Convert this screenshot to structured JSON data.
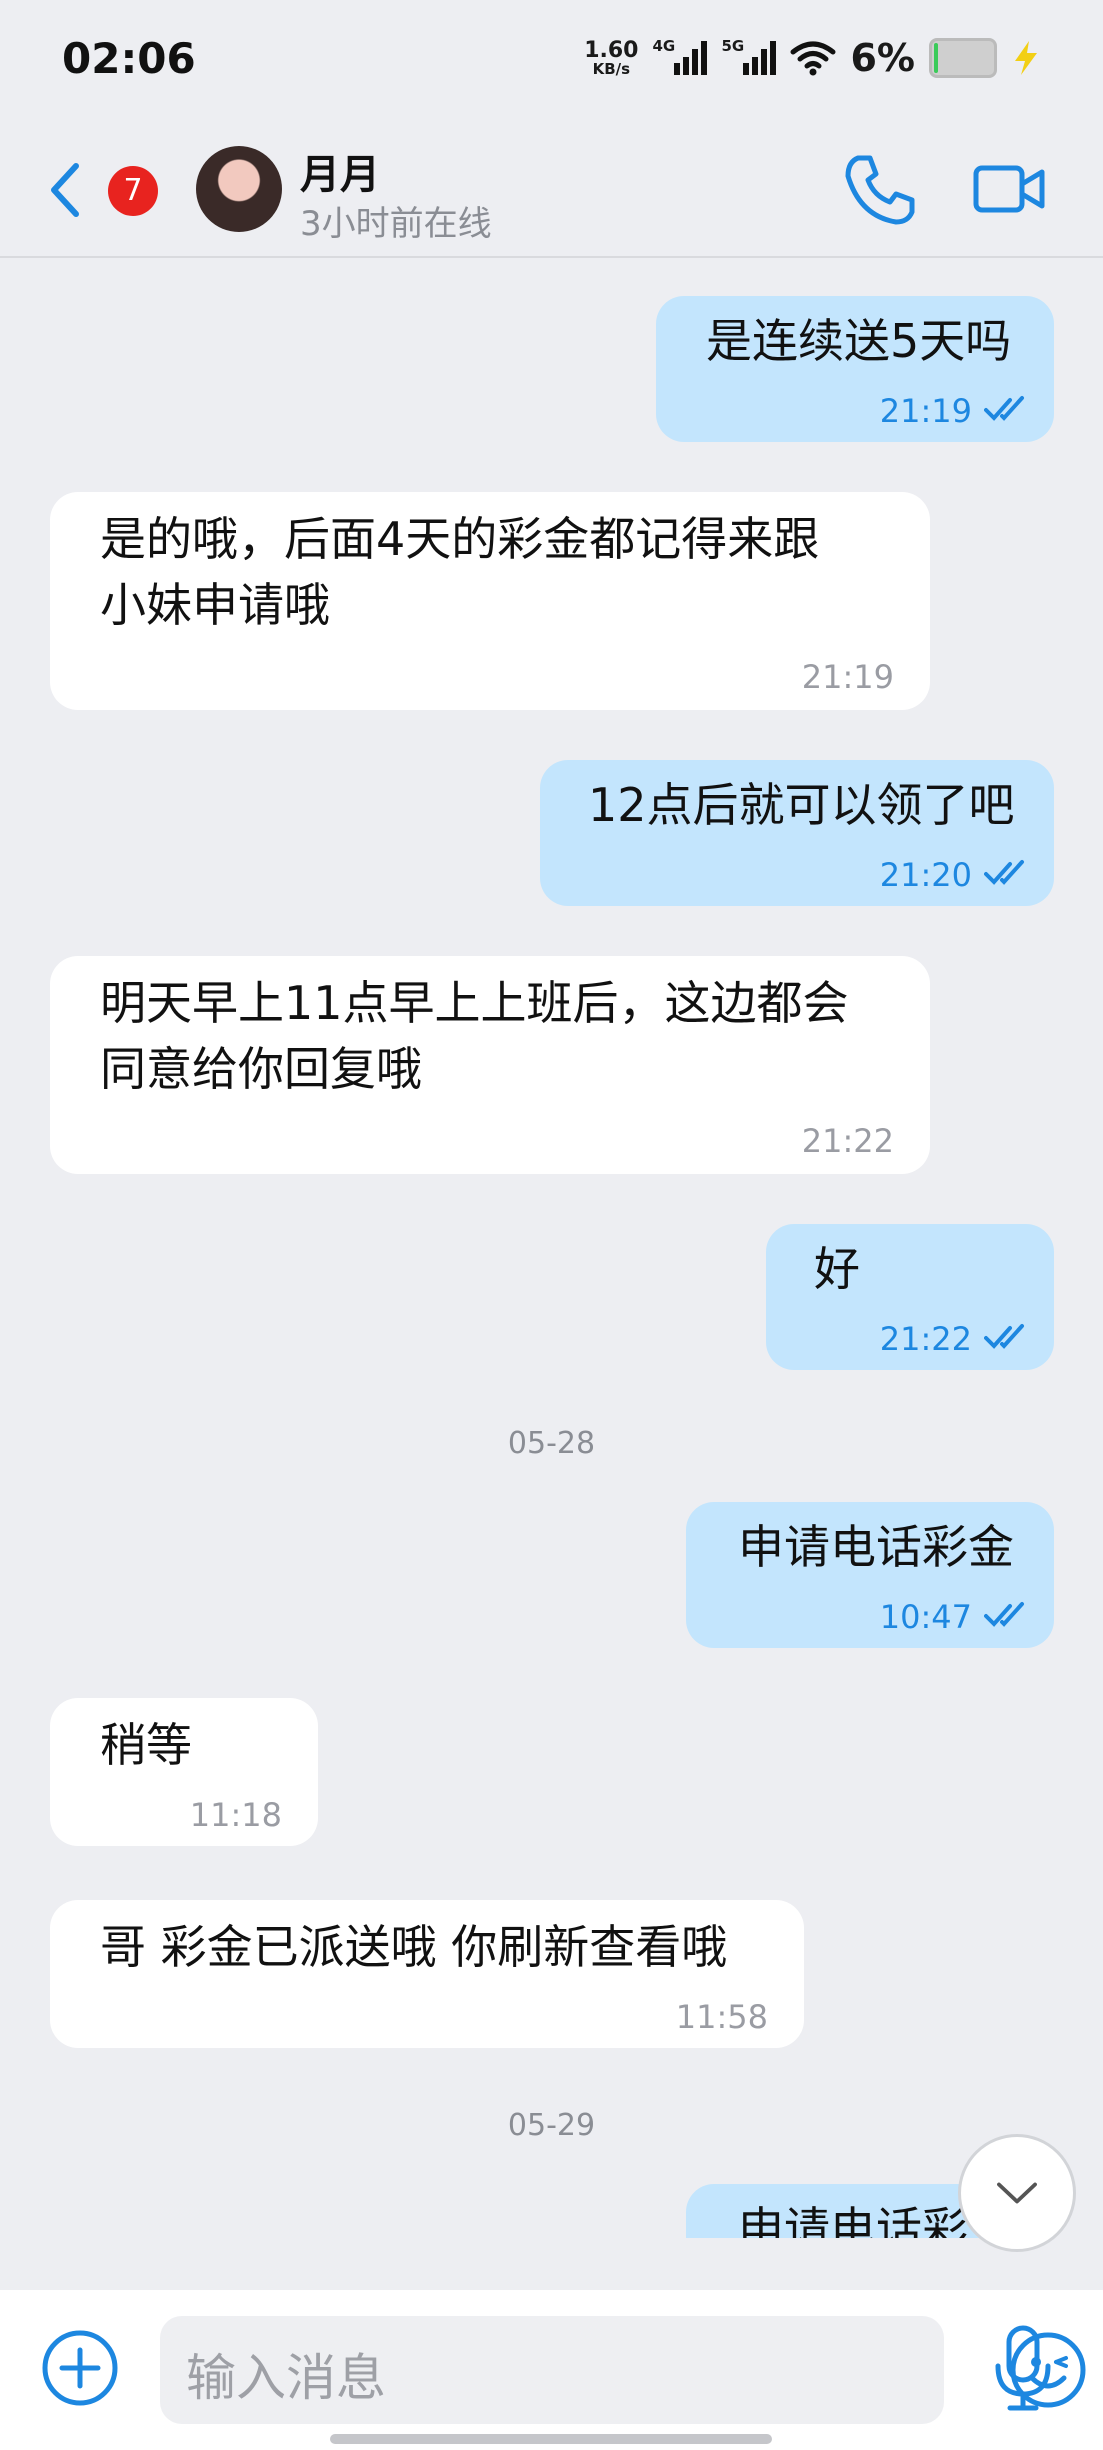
{
  "status_bar": {
    "time": "02:06",
    "speed_value": "1.60",
    "speed_unit": "KB/s",
    "net1": "4G",
    "net2": "5G",
    "battery_pct": "6%",
    "battery_level": 0.06
  },
  "header": {
    "unread_count": "7",
    "contact_name": "月月",
    "contact_status": "3小时前在线"
  },
  "messages": [
    {
      "dir": "out",
      "text": "是连续送5天吗",
      "time": "21:19"
    },
    {
      "dir": "in",
      "text": "是的哦，后面4天的彩金都记得来跟\n小妹申请哦",
      "time": "21:19"
    },
    {
      "dir": "out",
      "text": "12点后就可以领了吧",
      "time": "21:20"
    },
    {
      "dir": "in",
      "text": "明天早上11点早上上班后，这边都会\n同意给你回复哦",
      "time": "21:22"
    },
    {
      "dir": "out",
      "text": "好",
      "time": "21:22"
    },
    {
      "dir": "out",
      "text": "申请电话彩金",
      "time": "10:47"
    },
    {
      "dir": "in",
      "text": "稍等",
      "time": "11:18"
    },
    {
      "dir": "in",
      "text": "哥 彩金已派送哦 你刷新查看哦",
      "time": "11:58"
    },
    {
      "dir": "out",
      "text": "申请电话彩"
    }
  ],
  "date_separators": [
    "05-28",
    "05-29"
  ],
  "input": {
    "placeholder": "输入消息"
  },
  "icons": {
    "back": "chevron-left-icon",
    "call": "phone-icon",
    "video": "video-camera-icon",
    "add": "plus-circle-icon",
    "emoji": "smile-icon",
    "mic": "microphone-icon",
    "scroll": "chevron-down-icon"
  },
  "colors": {
    "accent": "#1d87e0",
    "outgoing_bubble": "#c3e5fd",
    "incoming_bubble": "#ffffff",
    "badge": "#e8231f",
    "background": "#edeef2"
  }
}
